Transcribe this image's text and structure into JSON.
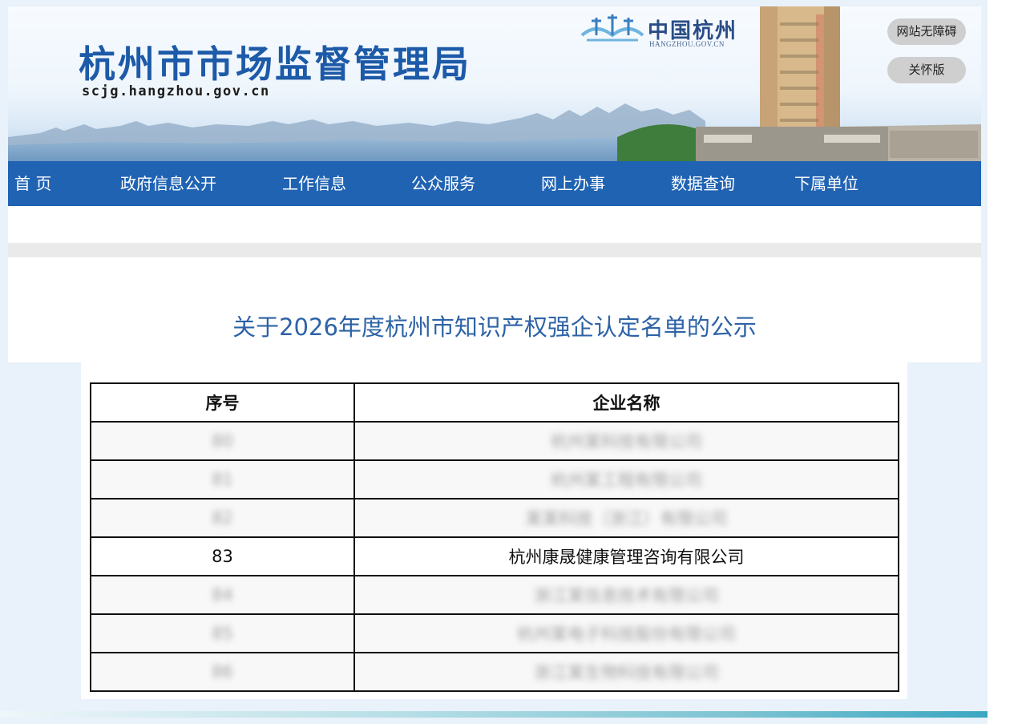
{
  "header": {
    "site_title": "杭州市市场监督管理局",
    "site_domain": "scjg.hangzhou.gov.cn",
    "logo_cn": "中国杭州",
    "logo_en": "HANGZHOU.GOV.CN",
    "accessibility_label": "网站无障碍",
    "care_mode_label": "关怀版"
  },
  "nav": {
    "items": [
      "首 页",
      "政府信息公开",
      "工作信息",
      "公众服务",
      "网上办事",
      "数据查询",
      "下属单位"
    ]
  },
  "article": {
    "title": "关于2026年度杭州市知识产权强企认定名单的公示"
  },
  "table": {
    "headers": [
      "序号",
      "企业名称"
    ],
    "rows": [
      {
        "no": "80",
        "name": "杭州某科技有限公司",
        "blurred": true
      },
      {
        "no": "81",
        "name": "杭州某工程有限公司",
        "blurred": true
      },
      {
        "no": "82",
        "name": "某某科技（浙江）有限公司",
        "blurred": true
      },
      {
        "no": "83",
        "name": "杭州康晟健康管理咨询有限公司",
        "blurred": false
      },
      {
        "no": "84",
        "name": "浙江某信息技术有限公司",
        "blurred": true
      },
      {
        "no": "85",
        "name": "杭州某电子科技股份有限公司",
        "blurred": true
      },
      {
        "no": "86",
        "name": "浙江某生物科技有限公司",
        "blurred": true
      }
    ]
  },
  "colors": {
    "nav_bg": "#2063b3",
    "title_blue": "#1d5aa8",
    "article_title": "#2d63a6"
  }
}
